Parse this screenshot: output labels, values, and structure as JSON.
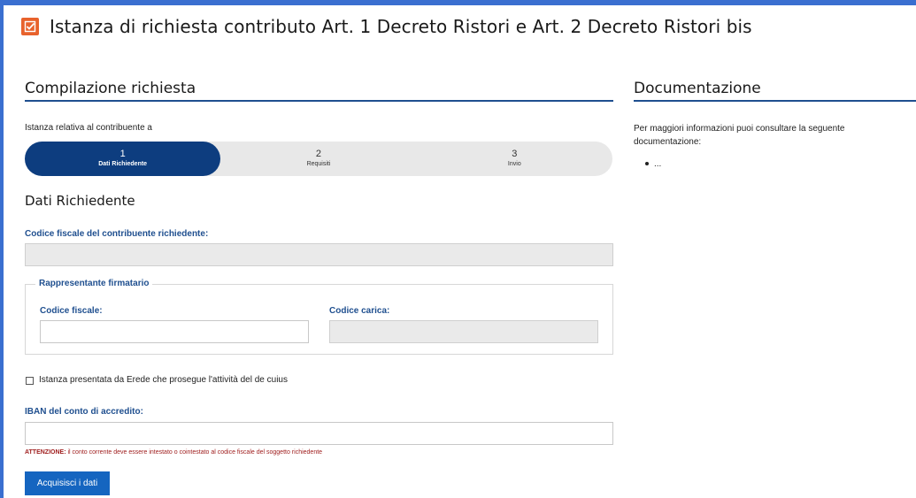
{
  "header": {
    "title": "Istanza di richiesta contributo Art. 1 Decreto Ristori e Art. 2 Decreto Ristori bis",
    "icon": "checkbox-icon",
    "icon_color": "#e8622c"
  },
  "left": {
    "section_title": "Compilazione richiesta",
    "intro": "Istanza relativa al contribuente a",
    "steps": [
      {
        "number": "1",
        "label": "Dati Richiedente",
        "active": true
      },
      {
        "number": "2",
        "label": "Requisiti",
        "active": false
      },
      {
        "number": "3",
        "label": "Invio",
        "active": false
      }
    ],
    "subheading": "Dati Richiedente",
    "cf_label": "Codice fiscale del contribuente richiedente:",
    "cf_value": "",
    "rappresentante": {
      "legend": "Rappresentante firmatario",
      "cf_label": "Codice fiscale:",
      "cf_value": "",
      "carica_label": "Codice carica:",
      "carica_value": ""
    },
    "erede_label": "Istanza presentata da Erede che prosegue l'attività del de cuius",
    "erede_checked": false,
    "iban_label": "IBAN del conto di accredito:",
    "iban_value": "",
    "warning_prefix": "ATTENZIONE:",
    "warning_text": " il conto corrente deve essere intestato o cointestato al codice fiscale del soggetto richiedente",
    "submit_label": "Acquisisci i dati"
  },
  "right": {
    "section_title": "Documentazione",
    "text": "Per maggiori informazioni puoi consultare la seguente documentazione:",
    "items": [
      "..."
    ]
  },
  "colors": {
    "accent": "#1f4f8f",
    "stepper_active": "#0d3d7f",
    "button": "#1565c0",
    "warning": "#a02020",
    "frame": "#3a6fd0"
  }
}
